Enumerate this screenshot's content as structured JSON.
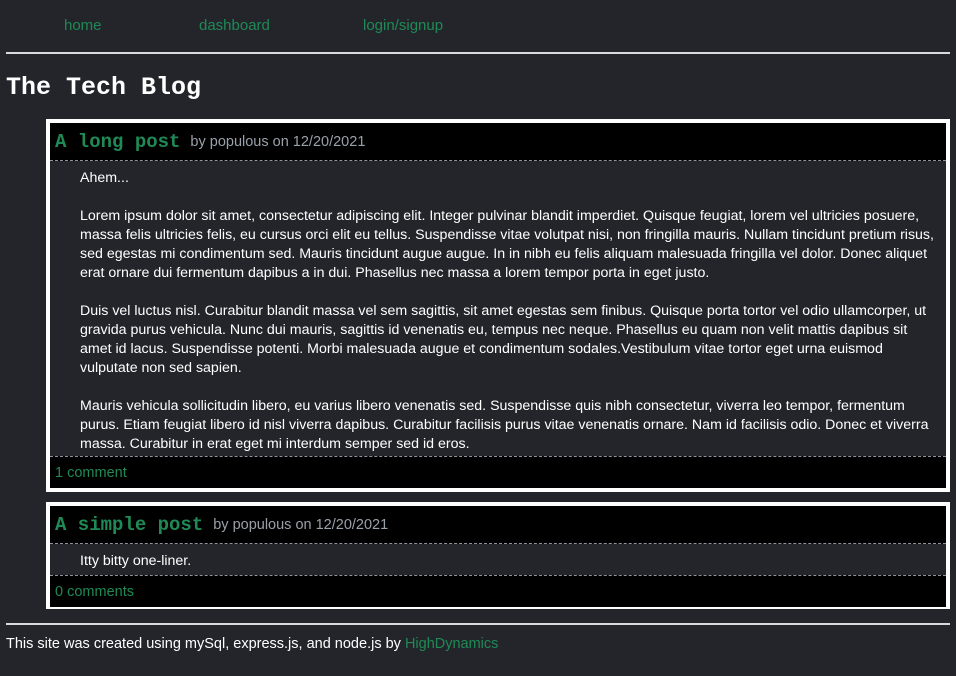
{
  "nav": {
    "home": "home",
    "dashboard": "dashboard",
    "login": "login/signup"
  },
  "site_title": "The Tech Blog",
  "posts": [
    {
      "title": "A long post",
      "meta": "by populous on 12/20/2021",
      "paragraphs": [
        "Ahem...",
        "Lorem ipsum dolor sit amet, consectetur adipiscing elit. Integer pulvinar blandit imperdiet. Quisque feugiat, lorem vel ultricies posuere, massa felis ultricies felis, eu cursus orci elit eu tellus. Suspendisse vitae volutpat nisi, non fringilla mauris. Nullam tincidunt pretium risus, sed egestas mi condimentum sed. Mauris tincidunt augue augue. In in nibh eu felis aliquam malesuada fringilla vel dolor. Donec aliquet erat ornare dui fermentum dapibus a in dui. Phasellus nec massa a lorem tempor porta in eget justo.",
        "Duis vel luctus nisl. Curabitur blandit massa vel sem sagittis, sit amet egestas sem finibus. Quisque porta tortor vel odio ullamcorper, ut gravida purus vehicula. Nunc dui mauris, sagittis id venenatis eu, tempus nec neque. Phasellus eu quam non velit mattis dapibus sit amet id lacus. Suspendisse potenti. Morbi malesuada augue et condimentum sodales.Vestibulum vitae tortor eget urna euismod vulputate non sed sapien.",
        "Mauris vehicula sollicitudin libero, eu varius libero venenatis sed. Suspendisse quis nibh consectetur, viverra leo tempor, fermentum purus. Etiam feugiat libero id nisl viverra dapibus. Curabitur facilisis purus vitae venenatis ornare. Nam id facilisis odio. Donec et viverra massa. Curabitur in erat eget mi interdum semper sed id eros."
      ],
      "comments": "1 comment"
    },
    {
      "title": "A simple post",
      "meta": "by populous on 12/20/2021",
      "paragraphs": [
        "Itty bitty one-liner."
      ],
      "comments": "0 comments"
    }
  ],
  "footer": {
    "text": "This site was created using mySql, express.js, and node.js by ",
    "link": "HighDynamics"
  },
  "colors": {
    "background": "#23252b",
    "accent": "#1f8a55",
    "meta": "#9aa0aa",
    "card_border": "#ffffff",
    "header_bg": "#000000"
  }
}
